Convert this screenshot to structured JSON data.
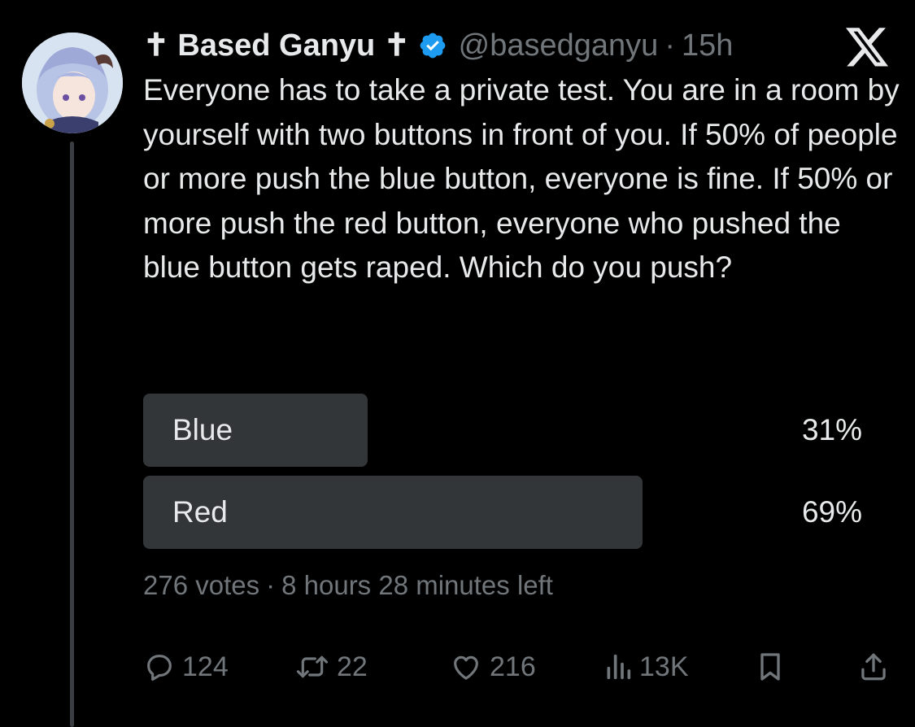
{
  "tweet": {
    "display_name": "✝ Based Ganyu ✝",
    "handle": "@basedganyu",
    "separator": "·",
    "time": "15h",
    "text": "Everyone has to take a private test. You are in a room by yourself with two buttons in front of you. If 50% of people or more push the blue button, everyone is fine. If 50% or more push the red button, everyone who pushed the blue button gets raped. Which do you push?"
  },
  "poll": {
    "options": [
      {
        "label": "Blue",
        "percent_text": "31%",
        "percent": 31
      },
      {
        "label": "Red",
        "percent_text": "69%",
        "percent": 69
      }
    ],
    "votes": "276 votes",
    "separator": "·",
    "time_left": "8 hours 28 minutes left"
  },
  "actions": {
    "replies": "124",
    "reposts": "22",
    "likes": "216",
    "views": "13K"
  },
  "icons": {
    "verified": "verified-badge-icon",
    "brand": "x-logo-icon",
    "reply": "reply-icon",
    "repost": "repost-icon",
    "like": "heart-icon",
    "views": "views-icon",
    "bookmark": "bookmark-icon",
    "share": "share-icon"
  },
  "colors": {
    "background": "#000000",
    "text": "#e7e9ea",
    "secondary": "#71767b",
    "verified": "#1d9bf0",
    "poll_bar": "#333639"
  }
}
